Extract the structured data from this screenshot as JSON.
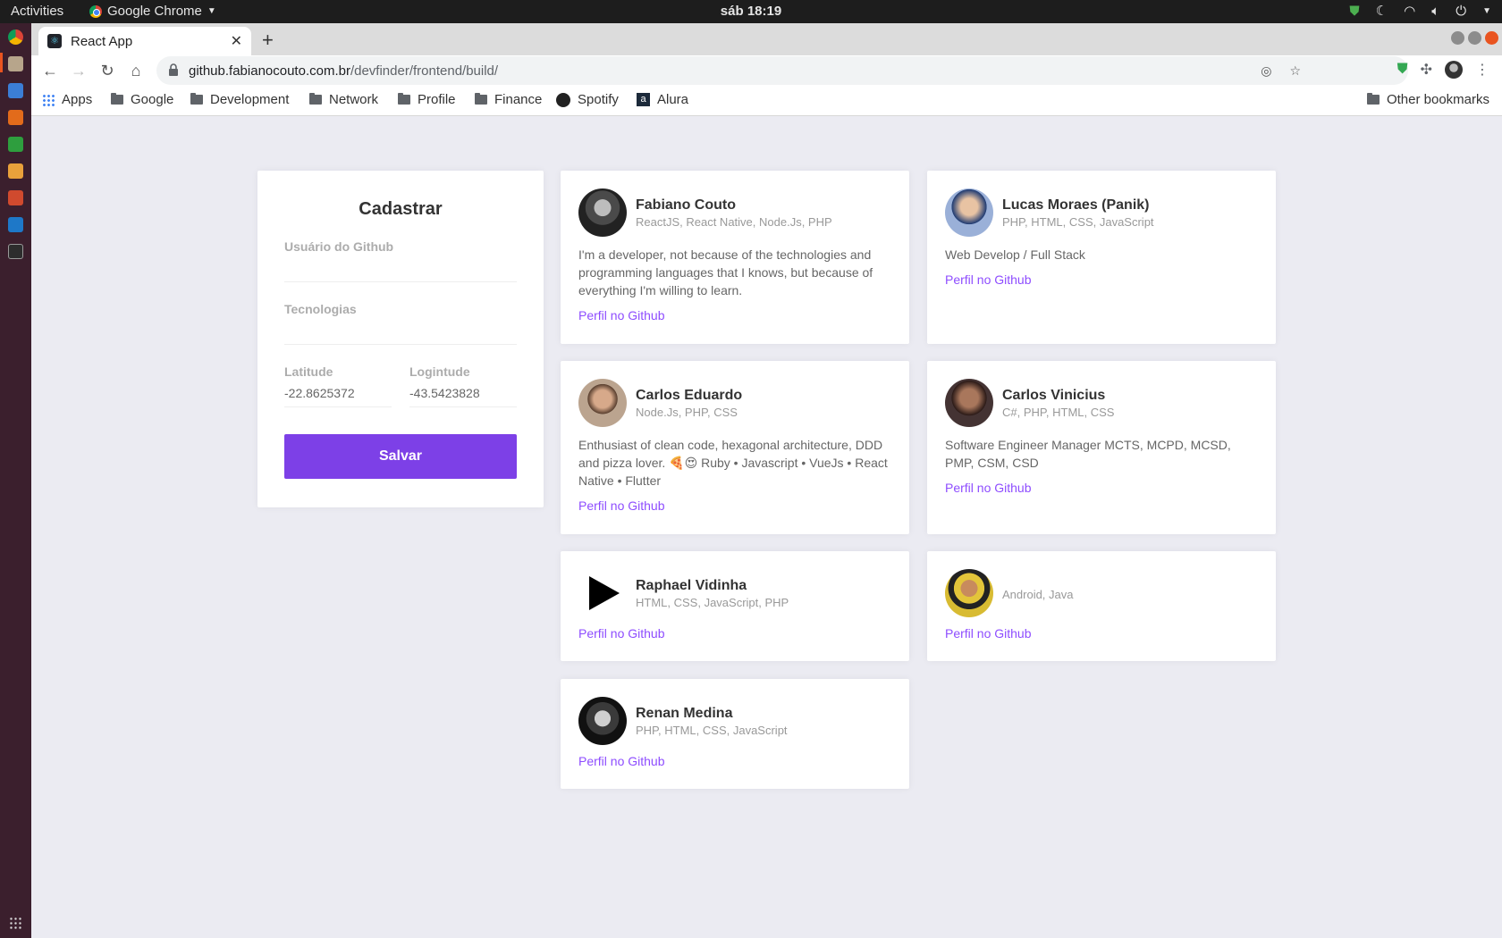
{
  "system": {
    "activities": "Activities",
    "app_name": "Google Chrome",
    "clock": "sáb 18:19"
  },
  "browser": {
    "tab_title": "React App",
    "url_host": "github.fabianocouto.com.br",
    "url_path": "/devfinder/frontend/build/",
    "bookmarks": [
      "Apps",
      "Google",
      "Development",
      "Network",
      "Profile",
      "Finance",
      "Spotify",
      "Alura"
    ],
    "other_bookmarks": "Other bookmarks"
  },
  "form": {
    "title": "Cadastrar",
    "github_label": "Usuário do Github",
    "github_value": "",
    "techs_label": "Tecnologias",
    "techs_value": "",
    "latitude_label": "Latitude",
    "latitude_value": "-22.8625372",
    "longitude_label": "Logintude",
    "longitude_value": "-43.5423828",
    "save_label": "Salvar"
  },
  "devs": [
    {
      "name": "Fabiano Couto",
      "techs": "ReactJS, React Native, Node.Js, PHP",
      "bio": "I'm a developer, not because of the technologies and programming languages that I knows, but because of everything I'm willing to learn.",
      "link": "Perfil no Github"
    },
    {
      "name": "Lucas Moraes (Panik)",
      "techs": "PHP, HTML, CSS, JavaScript",
      "bio": "Web Develop / Full Stack",
      "link": "Perfil no Github"
    },
    {
      "name": "Carlos Eduardo",
      "techs": "Node.Js, PHP, CSS",
      "bio": "Enthusiast of clean code, hexagonal architecture, DDD and pizza lover. 🍕😍 Ruby • Javascript • VueJs • React Native • Flutter",
      "link": "Perfil no Github"
    },
    {
      "name": "Carlos Vinicius",
      "techs": "C#, PHP, HTML, CSS",
      "bio": "Software Engineer Manager MCTS, MCPD, MCSD, PMP, CSM, CSD",
      "link": "Perfil no Github"
    },
    {
      "name": "Raphael Vidinha",
      "techs": "HTML, CSS, JavaScript, PHP",
      "bio": "",
      "link": "Perfil no Github"
    },
    {
      "name": "",
      "techs": "Android, Java",
      "bio": "",
      "link": "Perfil no Github"
    },
    {
      "name": "Renan Medina",
      "techs": "PHP, HTML, CSS, JavaScript",
      "bio": "",
      "link": "Perfil no Github"
    }
  ]
}
